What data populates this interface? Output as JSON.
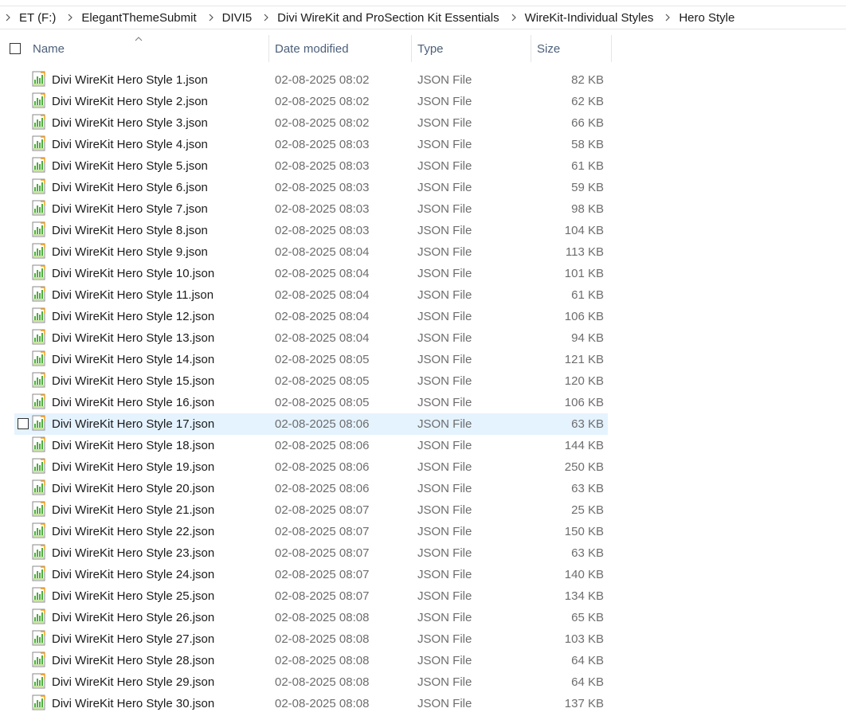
{
  "breadcrumb": [
    "ET (F:)",
    "ElegantThemeSubmit",
    "DIVI5",
    "Divi WireKit and ProSection Kit Essentials",
    "WireKit-Individual Styles",
    "Hero Style"
  ],
  "columns": {
    "name": "Name",
    "date": "Date modified",
    "type": "Type",
    "size": "Size"
  },
  "sort_indicator": "^",
  "hover_row_index": 16,
  "files": [
    {
      "name": "Divi WireKit Hero Style 1.json",
      "date": "02-08-2025 08:02",
      "type": "JSON File",
      "size": "82 KB"
    },
    {
      "name": "Divi WireKit Hero Style 2.json",
      "date": "02-08-2025 08:02",
      "type": "JSON File",
      "size": "62 KB"
    },
    {
      "name": "Divi WireKit Hero Style 3.json",
      "date": "02-08-2025 08:02",
      "type": "JSON File",
      "size": "66 KB"
    },
    {
      "name": "Divi WireKit Hero Style 4.json",
      "date": "02-08-2025 08:03",
      "type": "JSON File",
      "size": "58 KB"
    },
    {
      "name": "Divi WireKit Hero Style 5.json",
      "date": "02-08-2025 08:03",
      "type": "JSON File",
      "size": "61 KB"
    },
    {
      "name": "Divi WireKit Hero Style 6.json",
      "date": "02-08-2025 08:03",
      "type": "JSON File",
      "size": "59 KB"
    },
    {
      "name": "Divi WireKit Hero Style 7.json",
      "date": "02-08-2025 08:03",
      "type": "JSON File",
      "size": "98 KB"
    },
    {
      "name": "Divi WireKit Hero Style 8.json",
      "date": "02-08-2025 08:03",
      "type": "JSON File",
      "size": "104 KB"
    },
    {
      "name": "Divi WireKit Hero Style 9.json",
      "date": "02-08-2025 08:04",
      "type": "JSON File",
      "size": "113 KB"
    },
    {
      "name": "Divi WireKit Hero Style 10.json",
      "date": "02-08-2025 08:04",
      "type": "JSON File",
      "size": "101 KB"
    },
    {
      "name": "Divi WireKit Hero Style 11.json",
      "date": "02-08-2025 08:04",
      "type": "JSON File",
      "size": "61 KB"
    },
    {
      "name": "Divi WireKit Hero Style 12.json",
      "date": "02-08-2025 08:04",
      "type": "JSON File",
      "size": "106 KB"
    },
    {
      "name": "Divi WireKit Hero Style 13.json",
      "date": "02-08-2025 08:04",
      "type": "JSON File",
      "size": "94 KB"
    },
    {
      "name": "Divi WireKit Hero Style 14.json",
      "date": "02-08-2025 08:05",
      "type": "JSON File",
      "size": "121 KB"
    },
    {
      "name": "Divi WireKit Hero Style 15.json",
      "date": "02-08-2025 08:05",
      "type": "JSON File",
      "size": "120 KB"
    },
    {
      "name": "Divi WireKit Hero Style 16.json",
      "date": "02-08-2025 08:05",
      "type": "JSON File",
      "size": "106 KB"
    },
    {
      "name": "Divi WireKit Hero Style 17.json",
      "date": "02-08-2025 08:06",
      "type": "JSON File",
      "size": "63 KB"
    },
    {
      "name": "Divi WireKit Hero Style 18.json",
      "date": "02-08-2025 08:06",
      "type": "JSON File",
      "size": "144 KB"
    },
    {
      "name": "Divi WireKit Hero Style 19.json",
      "date": "02-08-2025 08:06",
      "type": "JSON File",
      "size": "250 KB"
    },
    {
      "name": "Divi WireKit Hero Style 20.json",
      "date": "02-08-2025 08:06",
      "type": "JSON File",
      "size": "63 KB"
    },
    {
      "name": "Divi WireKit Hero Style 21.json",
      "date": "02-08-2025 08:07",
      "type": "JSON File",
      "size": "25 KB"
    },
    {
      "name": "Divi WireKit Hero Style 22.json",
      "date": "02-08-2025 08:07",
      "type": "JSON File",
      "size": "150 KB"
    },
    {
      "name": "Divi WireKit Hero Style 23.json",
      "date": "02-08-2025 08:07",
      "type": "JSON File",
      "size": "63 KB"
    },
    {
      "name": "Divi WireKit Hero Style 24.json",
      "date": "02-08-2025 08:07",
      "type": "JSON File",
      "size": "140 KB"
    },
    {
      "name": "Divi WireKit Hero Style 25.json",
      "date": "02-08-2025 08:07",
      "type": "JSON File",
      "size": "134 KB"
    },
    {
      "name": "Divi WireKit Hero Style 26.json",
      "date": "02-08-2025 08:08",
      "type": "JSON File",
      "size": "65 KB"
    },
    {
      "name": "Divi WireKit Hero Style 27.json",
      "date": "02-08-2025 08:08",
      "type": "JSON File",
      "size": "103 KB"
    },
    {
      "name": "Divi WireKit Hero Style 28.json",
      "date": "02-08-2025 08:08",
      "type": "JSON File",
      "size": "64 KB"
    },
    {
      "name": "Divi WireKit Hero Style 29.json",
      "date": "02-08-2025 08:08",
      "type": "JSON File",
      "size": "64 KB"
    },
    {
      "name": "Divi WireKit Hero Style 30.json",
      "date": "02-08-2025 08:08",
      "type": "JSON File",
      "size": "137 KB"
    }
  ],
  "icons": {
    "chevron": "chevron-right-icon",
    "file": "json-file-icon",
    "sort": "sort-ascending-icon"
  },
  "colors": {
    "header_text": "#4c607a",
    "meta_text": "#6d6d6d",
    "hover_bg": "#e5f3ff",
    "icon_green": "#4caf3a"
  }
}
